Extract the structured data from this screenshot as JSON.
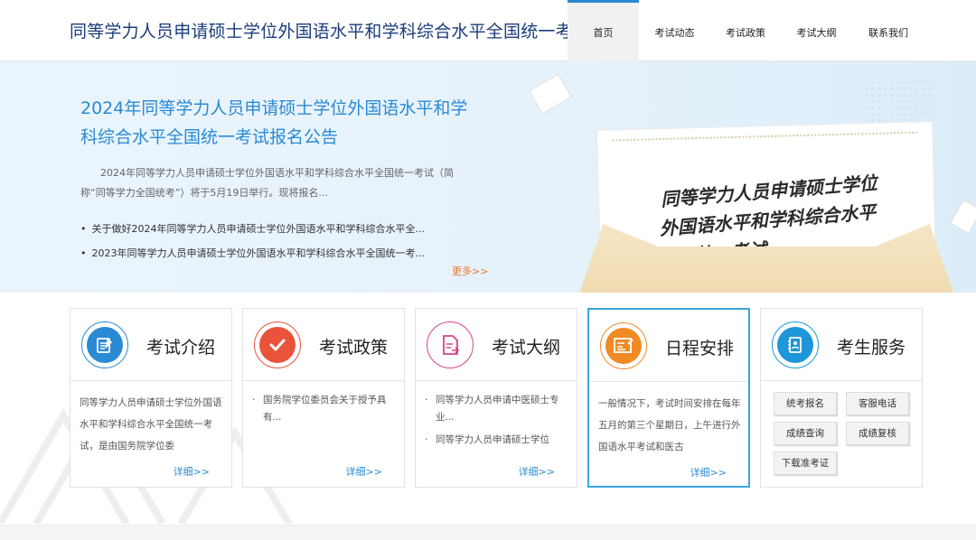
{
  "header": {
    "site_title": "同等学力人员申请硕士学位外国语水平和学科综合水平全国统一考试",
    "nav": [
      "首页",
      "考试动态",
      "考试政策",
      "考试大纲",
      "联系我们"
    ]
  },
  "banner": {
    "title": "2024年同等学力人员申请硕士学位外国语水平和学科综合水平全国统一考试报名公告",
    "desc": "2024年同等学力人员申请硕士学位外国语水平和学科综合水平全国统一考试（简称“同等学力全国统考”）将于5月19日举行。现将报名...",
    "list": [
      "关于做好2024年同等学力人员申请硕士学位外国语水平和学科综合水平全...",
      "2023年同等学力人员申请硕士学位外国语水平和学科综合水平全国统一考..."
    ],
    "more": "更多>>",
    "illustration_text": "同等学力人员申请硕士学位外国语水平和学科综合水平全国统一考试"
  },
  "cards": [
    {
      "title": "考试介绍",
      "icon": "document-edit-icon",
      "color": "#2a8ad4",
      "body": "同等学力人员申请硕士学位外国语水平和学科综合水平全国统一考试，是由国务院学位委",
      "more": "详细>>"
    },
    {
      "title": "考试政策",
      "icon": "checkmark-icon",
      "color": "#e8533a",
      "items": [
        "国务院学位委员会关于授予具有..."
      ],
      "more": "详细>>"
    },
    {
      "title": "考试大纲",
      "icon": "file-export-icon",
      "color": "#d8438a",
      "items": [
        "同等学力人员申请中医硕士专业...",
        "同等学力人员申请硕士学位"
      ],
      "more": "详细>>"
    },
    {
      "title": "日程安排",
      "icon": "schedule-board-icon",
      "color": "#f08a24",
      "body": "一般情况下，考试时间安排在每年五月的第三个星期日，上午进行外国语水平考试和医古",
      "more": "详细>>"
    },
    {
      "title": "考生服务",
      "icon": "contact-book-icon",
      "color": "#1e96d8",
      "buttons": [
        "统考报名",
        "客服电话",
        "成绩查询",
        "成绩复核",
        "下载准考证"
      ]
    }
  ]
}
